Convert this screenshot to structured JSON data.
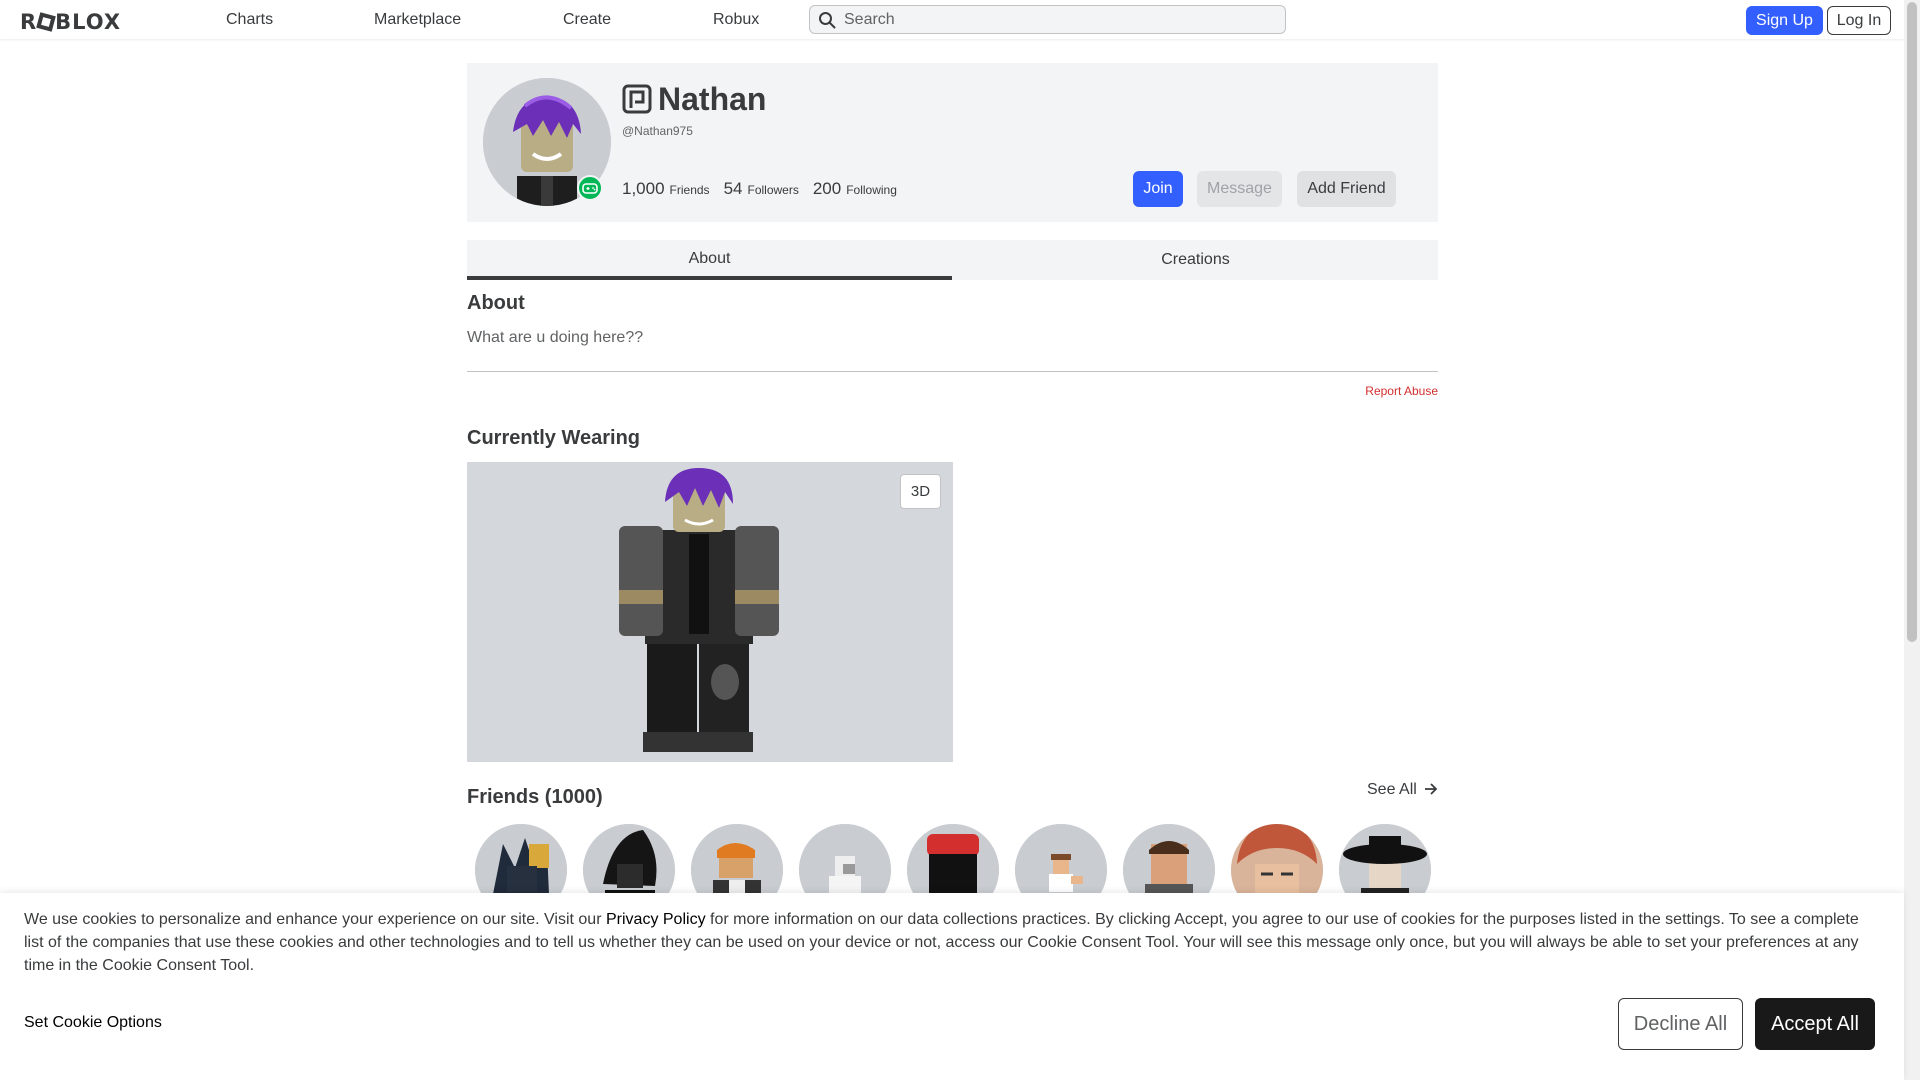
{
  "nav": {
    "logo_text": "ROBLOX",
    "links": [
      "Charts",
      "Marketplace",
      "Create",
      "Robux"
    ],
    "search_placeholder": "Search",
    "signup_label": "Sign Up",
    "login_label": "Log In"
  },
  "profile": {
    "display_name": "Nathan",
    "username": "@Nathan975",
    "friends_count": "1,000",
    "friends_label": "Friends",
    "followers_count": "54",
    "followers_label": "Followers",
    "following_count": "200",
    "following_label": "Following",
    "join_label": "Join",
    "message_label": "Message",
    "add_friend_label": "Add Friend",
    "verified_icon": "verified-badge-icon",
    "presence_icon": "in-game-icon"
  },
  "tabs": [
    "About",
    "Creations"
  ],
  "about": {
    "heading": "About",
    "text": "What are u doing here??",
    "report_label": "Report Abuse"
  },
  "wearing": {
    "heading": "Currently Wearing",
    "toggle_3d_label": "3D"
  },
  "friends": {
    "heading": "Friends (1000)",
    "see_all_label": "See All",
    "count_shown": 9
  },
  "cookie": {
    "text_before": "We use cookies to personalize and enhance your experience on our site. Visit our ",
    "privacy_link": "Privacy Policy",
    "text_after": " for more information on our data collections practices. By clicking Accept, you agree to our use of cookies for the purposes listed in the settings. To see a complete list of the companies that use these cookies and other technologies and to tell us whether they can be used on your device or not, access our Cookie Consent Tool. Your will see this message only once, but you will always be able to set your preferences at any time in the Cookie Consent Tool.",
    "options_label": "Set Cookie Options",
    "decline_label": "Decline All",
    "accept_label": "Accept All"
  },
  "colors": {
    "primary_blue": "#335fff",
    "presence_green": "#02b757",
    "report_red": "#d32f2f",
    "accept_black": "#191919"
  }
}
